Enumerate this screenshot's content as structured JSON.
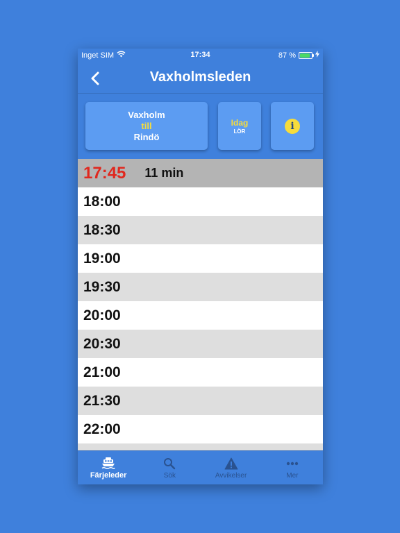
{
  "status_bar": {
    "carrier": "Inget SIM",
    "time": "17:34",
    "battery": "87 %",
    "battery_level": 0.87
  },
  "nav": {
    "title": "Vaxholmsleden"
  },
  "route": {
    "from": "Vaxholm",
    "connector": "till",
    "to": "Rindö"
  },
  "day": {
    "label": "Idag",
    "weekday": "LÖR"
  },
  "departures": [
    {
      "time": "17:45",
      "eta": "11 min",
      "next": true
    },
    {
      "time": "18:00"
    },
    {
      "time": "18:30"
    },
    {
      "time": "19:00"
    },
    {
      "time": "19:30"
    },
    {
      "time": "20:00"
    },
    {
      "time": "20:30"
    },
    {
      "time": "21:00"
    },
    {
      "time": "21:30"
    },
    {
      "time": "22:00"
    },
    {
      "time": ""
    }
  ],
  "tabs": [
    {
      "label": "Färjeleder",
      "icon": "ferry-icon",
      "active": true
    },
    {
      "label": "Sök",
      "icon": "search-icon",
      "active": false
    },
    {
      "label": "Avvikelser",
      "icon": "warning-icon",
      "active": false
    },
    {
      "label": "Mer",
      "icon": "more-icon",
      "active": false
    }
  ],
  "colors": {
    "background": "#3f80dc",
    "card": "#5c9cf2",
    "accent_yellow": "#f6dc3c",
    "next_time_red": "#e0281e"
  }
}
